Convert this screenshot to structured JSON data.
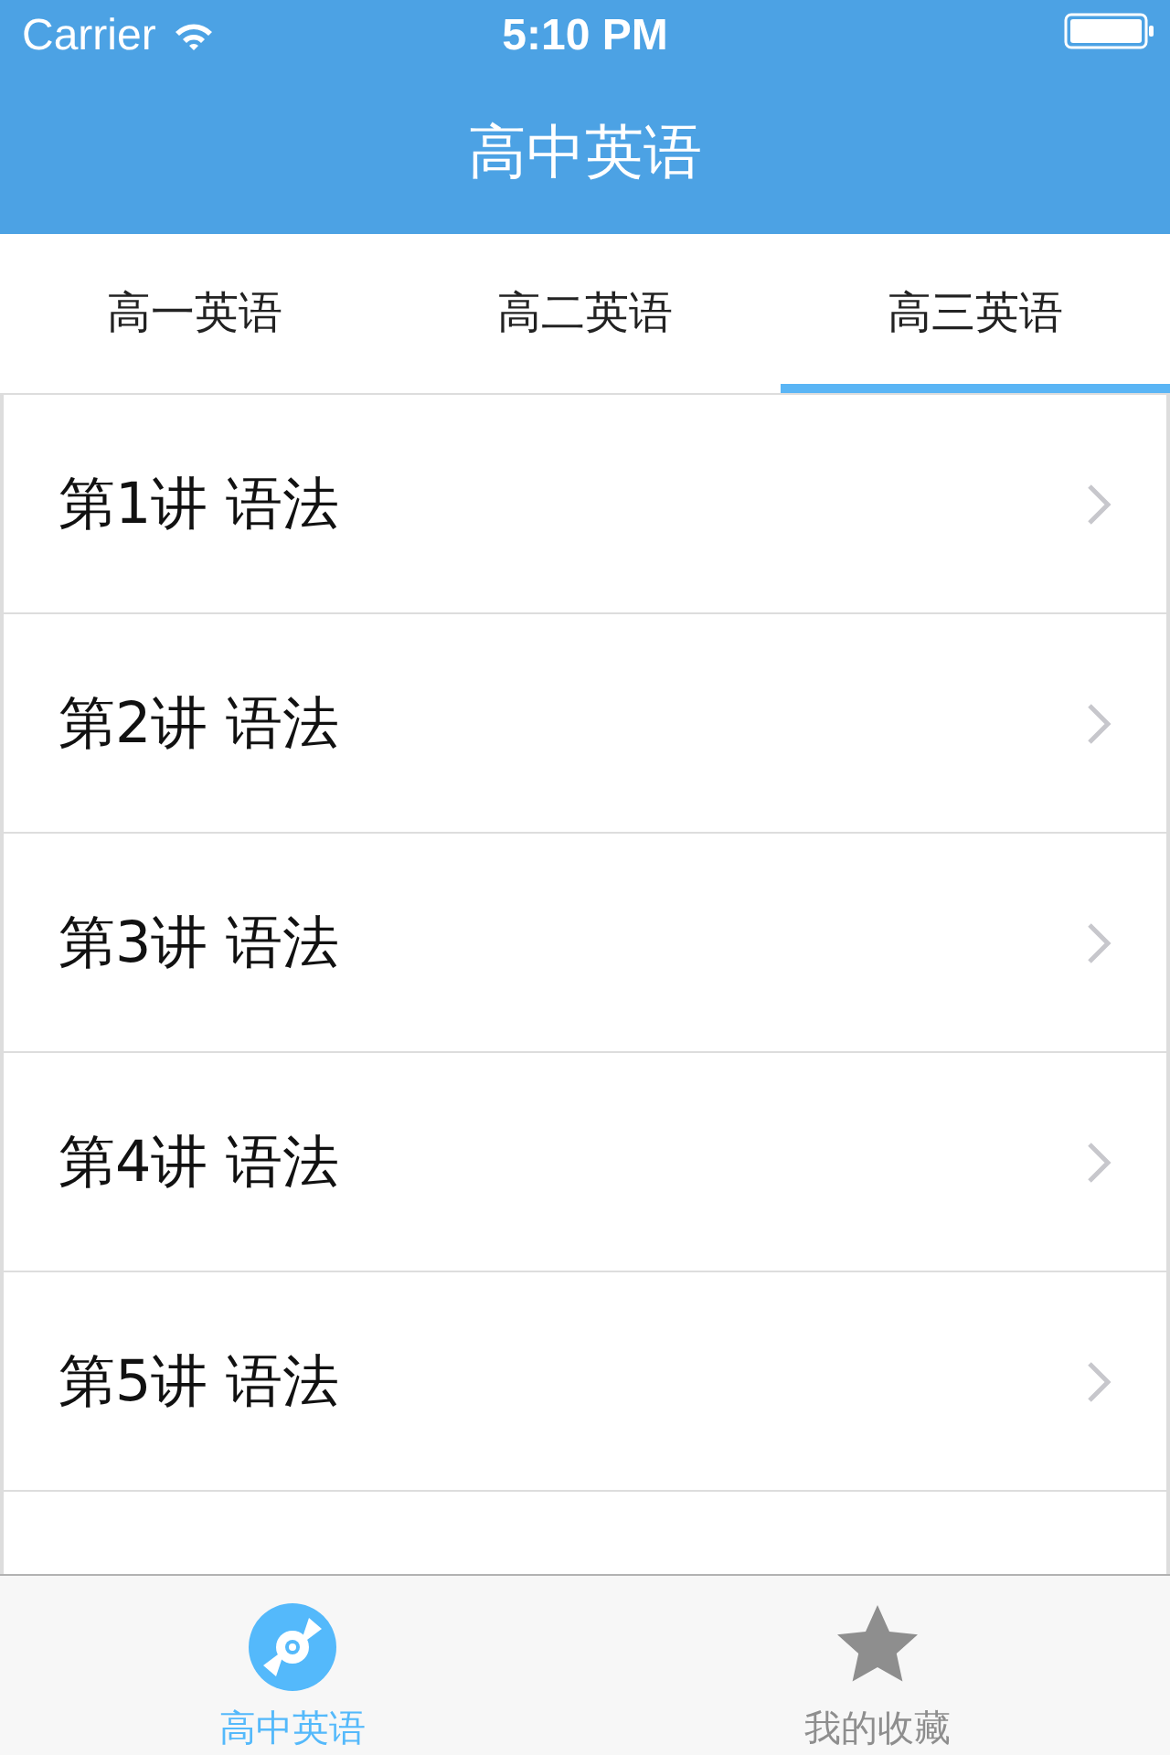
{
  "status_bar": {
    "carrier": "Carrier",
    "time": "5:10 PM"
  },
  "nav": {
    "title": "高中英语"
  },
  "tabs": [
    {
      "label": "高一英语",
      "selected": false
    },
    {
      "label": "高二英语",
      "selected": false
    },
    {
      "label": "高三英语",
      "selected": true
    }
  ],
  "lessons": [
    {
      "title": "第1讲 语法"
    },
    {
      "title": "第2讲 语法"
    },
    {
      "title": "第3讲 语法"
    },
    {
      "title": "第4讲 语法"
    },
    {
      "title": "第5讲 语法"
    }
  ],
  "tab_bar": [
    {
      "label": "高中英语",
      "kind": "disc",
      "selected": true
    },
    {
      "label": "我的收藏",
      "kind": "star",
      "selected": false
    }
  ]
}
